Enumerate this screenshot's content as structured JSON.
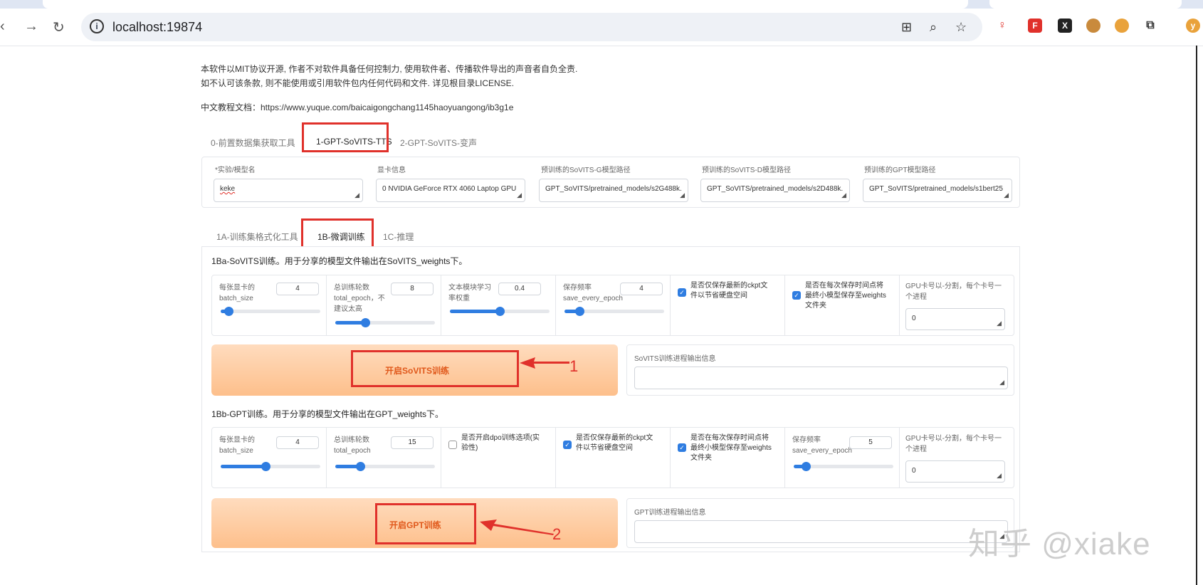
{
  "browser": {
    "url": "localhost:19874",
    "profile_initial": "y"
  },
  "notice": {
    "line1": "本软件以MIT协议开源, 作者不对软件具备任何控制力, 使用软件者、传播软件导出的声音者自负全责.",
    "line2": "如不认可该条款, 则不能使用或引用软件包内任何代码和文件. 详见根目录LICENSE.",
    "doc": "中文教程文档：https://www.yuque.com/baicaigongchang1145haoyuangong/ib3g1e"
  },
  "main_tabs": [
    {
      "label": "0-前置数据集获取工具"
    },
    {
      "label": "1-GPT-SoVITS-TTS"
    },
    {
      "label": "2-GPT-SoVITS-变声"
    }
  ],
  "config": {
    "exp_name_label": "*实验/模型名",
    "exp_name_value": "keke",
    "gpu_info_label": "显卡信息",
    "gpu_info_value": "0 NVIDIA GeForce RTX 4060 Laptop GPU",
    "sovits_g_label": "预训练的SoVITS-G模型路径",
    "sovits_g_value": "GPT_SoVITS/pretrained_models/s2G488k.",
    "sovits_d_label": "预训练的SoVITS-D模型路径",
    "sovits_d_value": "GPT_SoVITS/pretrained_models/s2D488k.",
    "gpt_label": "预训练的GPT模型路径",
    "gpt_value": "GPT_SoVITS/pretrained_models/s1bert25"
  },
  "sub_tabs": [
    {
      "label": "1A-训练集格式化工具"
    },
    {
      "label": "1B-微调训练"
    },
    {
      "label": "1C-推理"
    }
  ],
  "sovits": {
    "title": "1Ba-SoVITS训练。用于分享的模型文件输出在SoVITS_weights下。",
    "batch_label1": "每张显卡的",
    "batch_label2": "batch_size",
    "batch_value": "4",
    "batch_fraction": 0.08,
    "epoch_label1": "总训练轮数",
    "epoch_label2": "total_epoch，不",
    "epoch_label3": "建议太高",
    "epoch_value": "8",
    "epoch_fraction": 0.3,
    "textlr_label1": "文本模块学习",
    "textlr_label2": "率权重",
    "textlr_value": "0.4",
    "textlr_fraction": 0.5,
    "save_label1": "保存频率",
    "save_label2": "save_every_epoch",
    "save_value": "4",
    "save_fraction": 0.15,
    "latest_label1": "是否仅保存最新的ckpt文",
    "latest_label2": "件以节省硬盘空间",
    "small_label1": "是否在每次保存时间点将",
    "small_label2": "最终小模型保存至weights",
    "small_label3": "文件夹",
    "gpu_label1": "GPU卡号以-分割，每个卡号一",
    "gpu_label2": "个进程",
    "gpu_value": "0",
    "button": "开启SoVITS训练",
    "output_label": "SoVITS训练进程输出信息",
    "annotation": "1"
  },
  "gpt": {
    "title": "1Bb-GPT训练。用于分享的模型文件输出在GPT_weights下。",
    "batch_label1": "每张显卡的",
    "batch_label2": "batch_size",
    "batch_value": "4",
    "batch_fraction": 0.45,
    "epoch_label1": "总训练轮数",
    "epoch_label2": "total_epoch",
    "epoch_value": "15",
    "epoch_fraction": 0.25,
    "dpo_label1": "是否开启dpo训练选项(实",
    "dpo_label2": "验性)",
    "latest_label1": "是否仅保存最新的ckpt文",
    "latest_label2": "件以节省硬盘空间",
    "small_label1": "是否在每次保存时间点将",
    "small_label2": "最终小模型保存至weights",
    "small_label3": "文件夹",
    "save_label1": "保存频率",
    "save_label2": "save_every_epoch",
    "save_value": "5",
    "save_fraction": 0.12,
    "gpu_label1": "GPU卡号以-分割，每个卡号一",
    "gpu_label2": "个进程",
    "gpu_value": "0",
    "button": "开启GPT训练",
    "output_label": "GPT训练进程输出信息",
    "annotation": "2"
  },
  "watermark": "知乎 @xiake",
  "colors": {
    "accent": "#2f7de1",
    "annotation_red": "#e0312b",
    "button_text": "#e0581b"
  }
}
